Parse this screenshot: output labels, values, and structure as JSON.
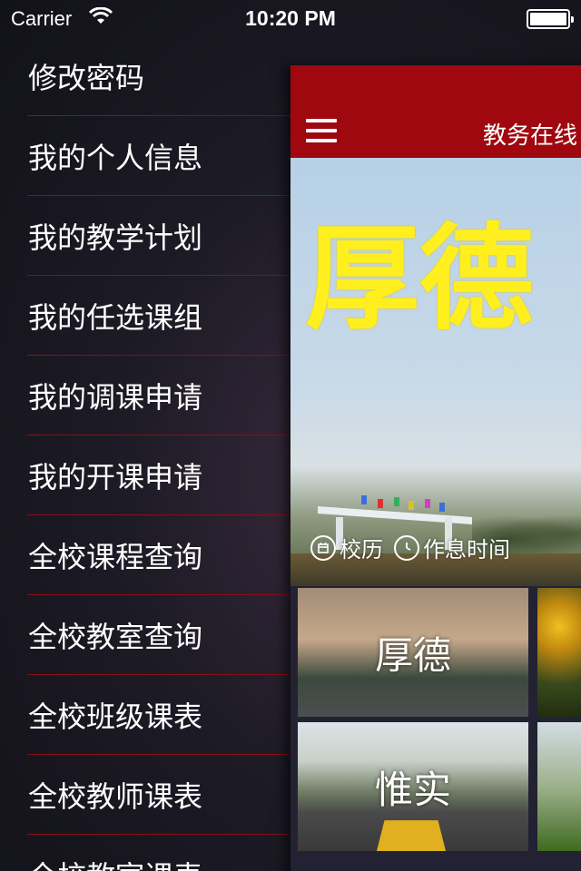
{
  "status_bar": {
    "carrier": "Carrier",
    "time": "10:20 PM"
  },
  "side_menu": {
    "items": [
      "修改密码",
      "我的个人信息",
      "我的教学计划",
      "我的任选课组",
      "我的调课申请",
      "我的开课申请",
      "全校课程查询",
      "全校教室查询",
      "全校班级课表",
      "全校教师课表",
      "全校教室课表"
    ]
  },
  "main": {
    "nav_title": "教务在线",
    "banner_text": "厚德",
    "quick_links": [
      {
        "label": "校历",
        "icon": "calendar-icon"
      },
      {
        "label": "作息时间",
        "icon": "clock-icon"
      }
    ],
    "tiles": [
      "厚德",
      "",
      "惟实",
      ""
    ]
  },
  "colors": {
    "nav_bar": "#a00810",
    "menu_divider": "#8a0f16",
    "banner_text": "#ffef1e"
  }
}
